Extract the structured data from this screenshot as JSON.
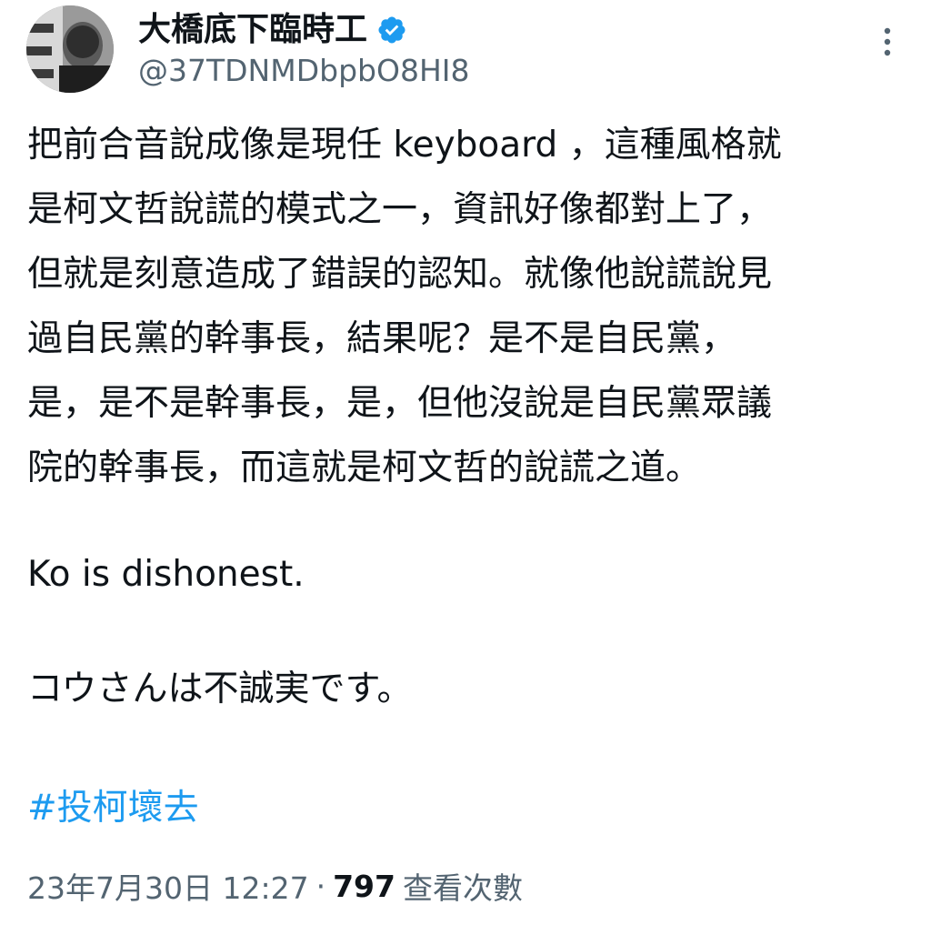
{
  "author": {
    "display_name": "大橋底下臨時工",
    "handle": "@37TDNMDbpbO8HI8",
    "verified_icon": "verified-badge-icon",
    "avatar_icon": "avatar-photo"
  },
  "menu": {
    "icon": "more-options-icon"
  },
  "tweet": {
    "lines": [
      "把前合音說成像是現任 keyboard ，這種風格就",
      "是柯文哲說謊的模式之一，資訊好像都對上了，",
      "但就是刻意造成了錯誤的認知。就像他說謊說見",
      "過自民黨的幹事長，結果呢？是不是自民黨，",
      "是，是不是幹事長，是，但他沒說是自民黨眾議",
      "院的幹事長，而這就是柯文哲的說謊之道。"
    ],
    "english": "Ko is dishonest.",
    "japanese": "コウさんは不誠実です。",
    "hashtag": "#投柯壞去"
  },
  "meta": {
    "timestamp": "23年7月30日 12:27",
    "separator": "·",
    "views_count": "797",
    "views_label": "查看次數"
  },
  "colors": {
    "text": "#0f1419",
    "secondary": "#536471",
    "link": "#1d9bf0",
    "verified": "#1d9bf0"
  }
}
